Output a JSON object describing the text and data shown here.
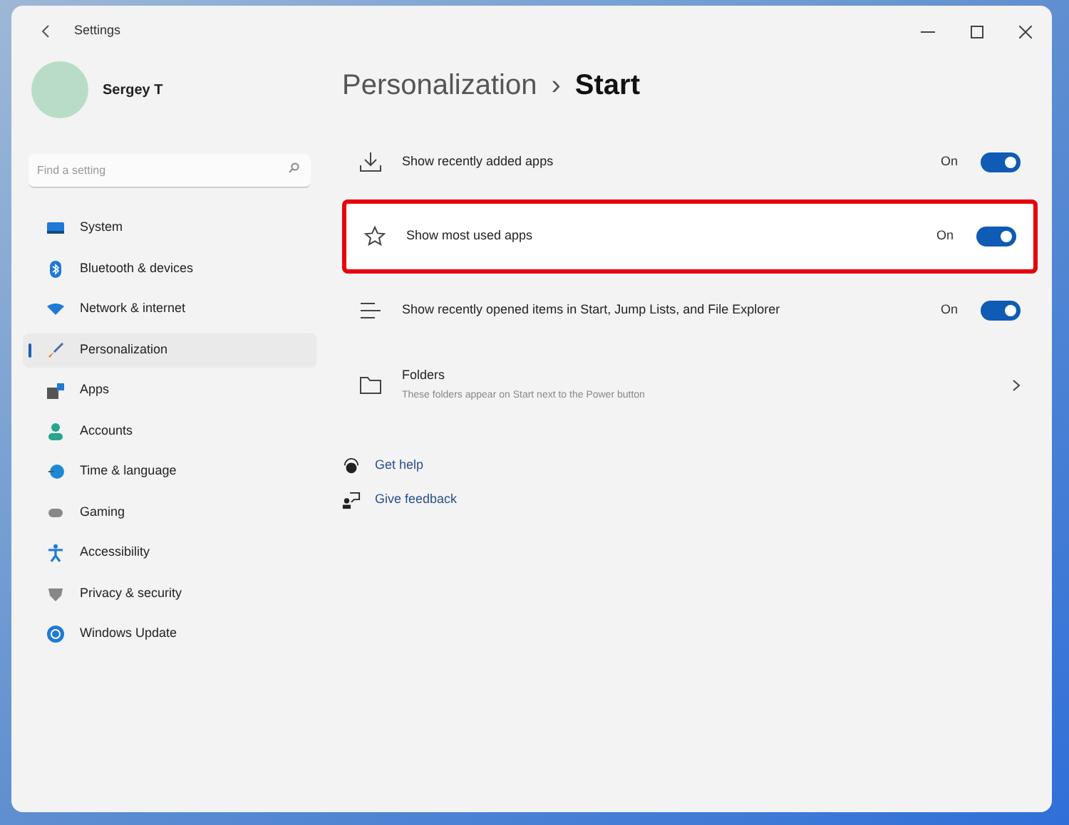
{
  "window": {
    "title": "Settings"
  },
  "user": {
    "name": "Sergey T"
  },
  "search": {
    "placeholder": "Find a setting"
  },
  "sidebar": {
    "items": [
      {
        "label": "System",
        "selected": false
      },
      {
        "label": "Bluetooth & devices",
        "selected": false
      },
      {
        "label": "Network & internet",
        "selected": false
      },
      {
        "label": "Personalization",
        "selected": true
      },
      {
        "label": "Apps",
        "selected": false
      },
      {
        "label": "Accounts",
        "selected": false
      },
      {
        "label": "Time & language",
        "selected": false
      },
      {
        "label": "Gaming",
        "selected": false
      },
      {
        "label": "Accessibility",
        "selected": false
      },
      {
        "label": "Privacy & security",
        "selected": false
      },
      {
        "label": "Windows Update",
        "selected": false
      }
    ]
  },
  "breadcrumb": {
    "parent": "Personalization",
    "separator": "›",
    "current": "Start"
  },
  "settings": [
    {
      "kind": "toggle",
      "label": "Show recently added apps",
      "state_text": "On",
      "on": true,
      "highlighted": false
    },
    {
      "kind": "toggle",
      "label": "Show most used apps",
      "state_text": "On",
      "on": true,
      "highlighted": true
    },
    {
      "kind": "toggle",
      "label": "Show recently opened items in Start, Jump Lists, and File Explorer",
      "state_text": "On",
      "on": true,
      "highlighted": false
    },
    {
      "kind": "link",
      "label": "Folders",
      "description": "These folders appear on Start next to the Power button",
      "highlighted": false
    }
  ],
  "links": [
    {
      "label": "Get help"
    },
    {
      "label": "Give feedback"
    }
  ]
}
